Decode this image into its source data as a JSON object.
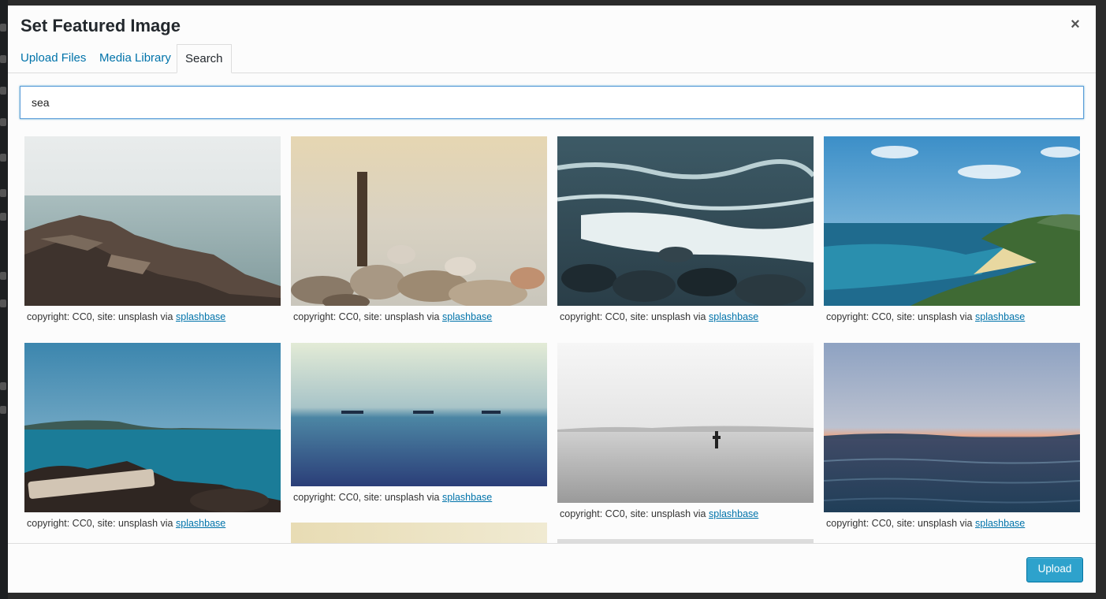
{
  "dialog": {
    "title": "Set Featured Image",
    "close_icon": "×"
  },
  "tabs": [
    {
      "label": "Upload Files"
    },
    {
      "label": "Media Library"
    },
    {
      "label": "Search"
    }
  ],
  "search": {
    "value": "sea"
  },
  "results": [
    {
      "caption_text": "copyright: CC0, site: unsplash via",
      "link": "splashbase",
      "scene": "rocky shoreline with calm pale sea"
    },
    {
      "caption_text": "copyright: CC0, site: unsplash via",
      "link": "splashbase",
      "scene": "wooden post on pebble beach, misty sea"
    },
    {
      "caption_text": "copyright: CC0, site: unsplash via",
      "link": "splashbase",
      "scene": "foamy waves over dark boulders"
    },
    {
      "caption_text": "copyright: CC0, site: unsplash via",
      "link": "splashbase",
      "scene": "green headland and sandy bay under blue sky"
    },
    {
      "caption_text": "copyright: CC0, site: unsplash via",
      "link": "splashbase",
      "scene": "turquoise sea with rocks and driftwood"
    },
    {
      "caption_text": "copyright: CC0, site: unsplash via",
      "link": "splashbase",
      "scene": "three ships on hazy blue horizon"
    },
    {
      "caption_text": "copyright: CC0, site: unsplash via",
      "link": "splashbase",
      "scene": "grey calm sea with marker pole"
    },
    {
      "caption_text": "copyright: CC0, site: unsplash via",
      "link": "splashbase",
      "scene": "sunset over rippled sea"
    }
  ],
  "footer": {
    "upload_label": "Upload"
  },
  "colors": {
    "link": "#0073aa",
    "primary_button": "#2ea2cc",
    "focus_border": "#5b9dd9"
  }
}
